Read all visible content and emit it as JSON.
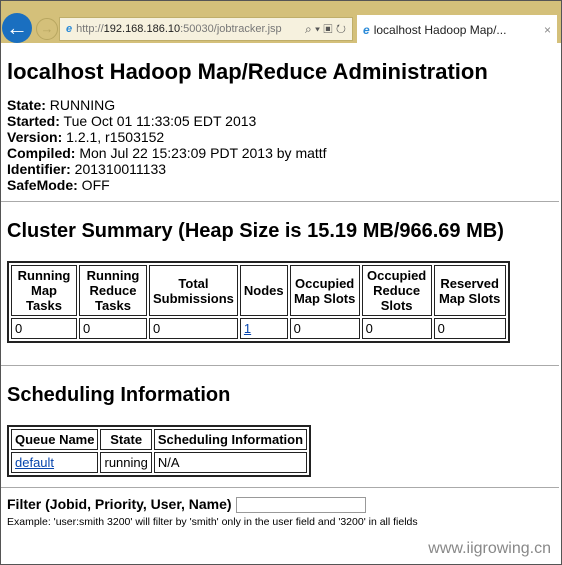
{
  "browser": {
    "url_prefix": "http://",
    "url_host": "192.168.186.10",
    "url_rest": ":50030/jobtracker.jsp",
    "tab_title": "localhost Hadoop Map/...",
    "search_icon": "⌕ ▾",
    "compat_icon": "▣",
    "refresh_icon": "↻",
    "close": "×",
    "back": "←",
    "forward": "→",
    "ie": "e"
  },
  "title": "localhost Hadoop Map/Reduce Administration",
  "info": [
    {
      "label": "State:",
      "value": " RUNNING"
    },
    {
      "label": "Started:",
      "value": " Tue Oct 01 11:33:05 EDT 2013"
    },
    {
      "label": "Version:",
      "value": " 1.2.1, r1503152"
    },
    {
      "label": "Compiled:",
      "value": " Mon Jul 22 15:23:09 PDT 2013 by mattf"
    },
    {
      "label": "Identifier:",
      "value": " 201310011133"
    },
    {
      "label": "SafeMode:",
      "value": " OFF"
    }
  ],
  "cluster": {
    "heading": "Cluster Summary (Heap Size is 15.19 MB/966.69 MB)",
    "headers": [
      "Running Map Tasks",
      "Running Reduce Tasks",
      "Total Submissions",
      "Nodes",
      "Occupied Map Slots",
      "Occupied Reduce Slots",
      "Reserved Map Slots"
    ],
    "values": [
      "0",
      "0",
      "0",
      "1",
      "0",
      "0",
      "0"
    ]
  },
  "scheduling": {
    "heading": "Scheduling Information",
    "headers": [
      "Queue Name",
      "State",
      "Scheduling Information"
    ],
    "row": [
      "default",
      "running",
      "N/A"
    ]
  },
  "filter": {
    "label": "Filter (Jobid, Priority, User, Name)",
    "value": "",
    "example": "Example: 'user:smith 3200' will filter by 'smith' only in the user field and '3200' in all fields"
  },
  "watermark": "www.iigrowing.cn"
}
